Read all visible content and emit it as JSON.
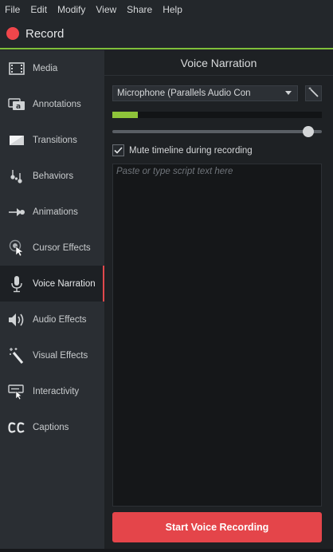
{
  "menu": [
    "File",
    "Edit",
    "Modify",
    "View",
    "Share",
    "Help"
  ],
  "record": {
    "label": "Record",
    "dot_color": "#f0464b"
  },
  "sidebar": {
    "items": [
      {
        "label": "Media",
        "icon": "film-strip-icon"
      },
      {
        "label": "Annotations",
        "icon": "annotation-icon"
      },
      {
        "label": "Transitions",
        "icon": "transition-icon"
      },
      {
        "label": "Behaviors",
        "icon": "behaviors-icon"
      },
      {
        "label": "Animations",
        "icon": "animation-arrow-icon"
      },
      {
        "label": "Cursor Effects",
        "icon": "cursor-effects-icon"
      },
      {
        "label": "Voice Narration",
        "icon": "microphone-icon",
        "active": true
      },
      {
        "label": "Audio Effects",
        "icon": "speaker-icon"
      },
      {
        "label": "Visual Effects",
        "icon": "magic-wand-icon"
      },
      {
        "label": "Interactivity",
        "icon": "interactivity-icon"
      },
      {
        "label": "Captions",
        "icon": "captions-icon"
      }
    ]
  },
  "panel": {
    "title": "Voice Narration",
    "mic_select": "Microphone (Parallels Audio Con",
    "input_level": 0.12,
    "volume": 0.96,
    "mute_checked": true,
    "mute_label": "Mute timeline during recording",
    "script_placeholder": "Paste or type script text here",
    "start_button": "Start Voice Recording"
  },
  "colors": {
    "accent_red": "#e4454a",
    "level_green": "#8ec43a",
    "active_border": "#e0484c",
    "record_underline": "#7fbf3a"
  }
}
